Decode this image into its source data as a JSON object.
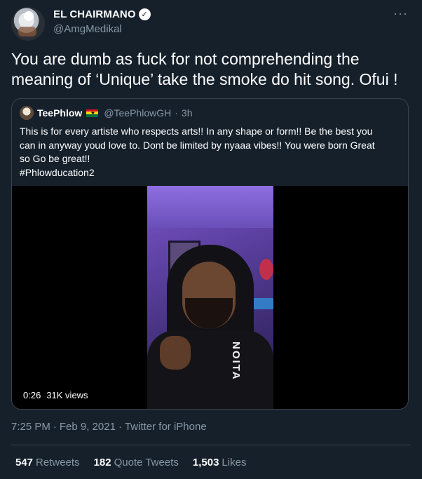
{
  "author": {
    "display_name": "EL CHAIRMANO",
    "handle": "@AmgMedikal",
    "verified_glyph": "✓"
  },
  "more_glyph": "···",
  "tweet_text": "You are dumb as fuck for not comprehending the meaning of ‘Unique’ take the smoke do hit song. Ofui !",
  "quoted": {
    "display_name": "TeePhlow",
    "flag": "ghana-flag",
    "handle": "@TeePhlowGH",
    "time": "3h",
    "separator": "·",
    "lines": [
      "This is for every artiste who respects arts!! In any shape or form!! Be the best you",
      "can in anyway youd love to. Dont be limited by nyaaa vibes!! You were born Great",
      "so Go be great!!",
      "#Phlowducation2"
    ],
    "video": {
      "duration": "0:26",
      "views": "31K views",
      "shirt_text": "NOITA"
    }
  },
  "timestamp": {
    "time": "7:25 PM",
    "date": "Feb 9, 2021",
    "source": "Twitter for iPhone",
    "separator": "·"
  },
  "stats": {
    "retweets": {
      "count": "547",
      "label": "Retweets"
    },
    "quote_tweets": {
      "count": "182",
      "label": "Quote Tweets"
    },
    "likes": {
      "count": "1,503",
      "label": "Likes"
    }
  },
  "colors": {
    "background": "#15202b",
    "secondary_text": "#8899a6",
    "border": "#38444d"
  }
}
